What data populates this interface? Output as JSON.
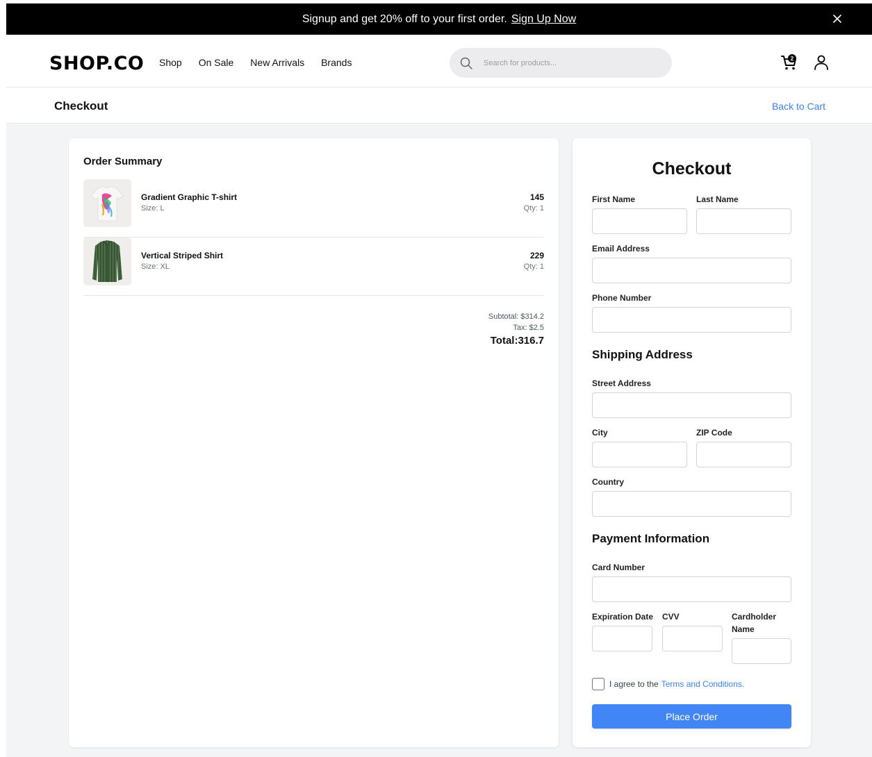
{
  "promo": {
    "text": "Signup and get 20% off to your first order.",
    "link": "Sign Up Now"
  },
  "header": {
    "logo": "SHOP.CO",
    "nav": [
      "Shop",
      "On Sale",
      "New Arrivals",
      "Brands"
    ],
    "search_placeholder": "Search for products...",
    "cart_count": "2"
  },
  "page": {
    "title": "Checkout",
    "back_link": "Back to Cart"
  },
  "summary": {
    "title": "Order Summary",
    "items": [
      {
        "name": "Gradient Graphic T-shirt",
        "size": "Size: L",
        "price": "145",
        "qty": "Qty: 1",
        "image": "tshirt-image"
      },
      {
        "name": "Vertical Striped Shirt",
        "size": "Size: XL",
        "price": "229",
        "qty": "Qty: 1",
        "image": "striped-shirt-image"
      }
    ],
    "subtotal": "Subtotal: $314.2",
    "tax": "Tax: $2.5",
    "total": "Total:316.7"
  },
  "checkout": {
    "title": "Checkout",
    "first_name": "First Name",
    "last_name": "Last Name",
    "email": "Email Address",
    "phone": "Phone Number",
    "shipping_title": "Shipping Address",
    "street": "Street Address",
    "city": "City",
    "zip": "ZIP Code",
    "country": "Country",
    "payment_title": "Payment Information",
    "card_number": "Card Number",
    "expiration": "Expiration Date",
    "cvv": "CVV",
    "cardholder": "Cardholder Name",
    "terms_prefix": "I agree to the",
    "terms_link": "Terms and Conditions.",
    "place_order": "Place Order"
  },
  "colors": {
    "accent": "#4285f4",
    "link": "#3b82f6",
    "promo_bg": "#000000",
    "page_bg": "#f3f4f6"
  }
}
